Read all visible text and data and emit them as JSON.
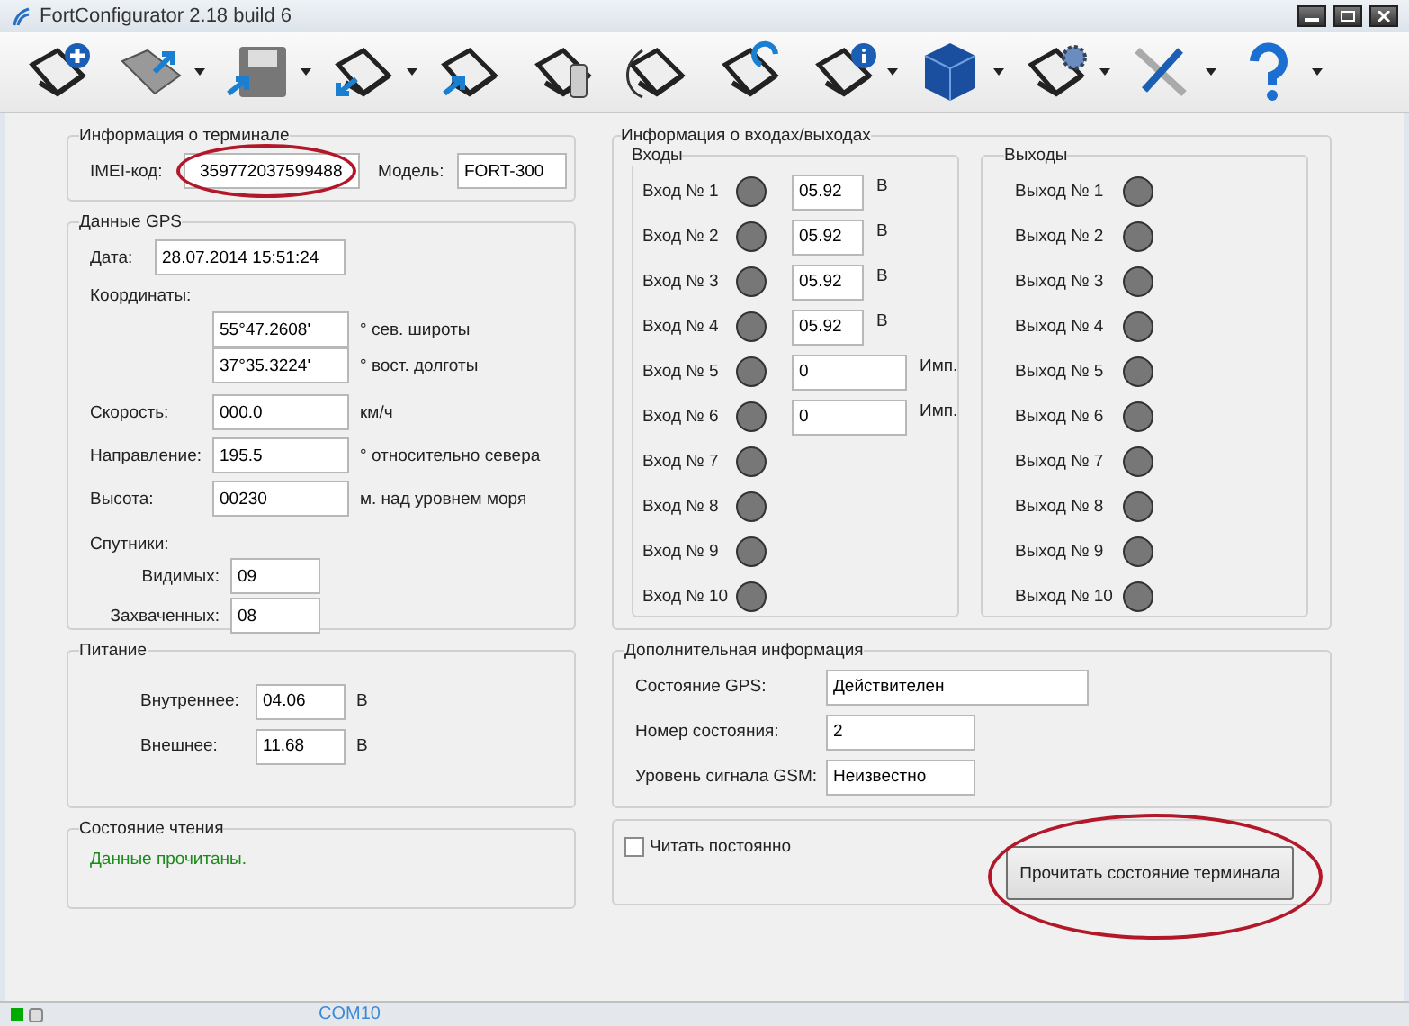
{
  "window": {
    "title": "FortConfigurator 2.18 build 6"
  },
  "toolbar": [
    {
      "kind": "add",
      "dropdown": false
    },
    {
      "kind": "folder",
      "dropdown": true
    },
    {
      "kind": "save",
      "dropdown": true
    },
    {
      "kind": "download",
      "dropdown": true
    },
    {
      "kind": "upload",
      "dropdown": false
    },
    {
      "kind": "phone",
      "dropdown": false
    },
    {
      "kind": "cable",
      "dropdown": false
    },
    {
      "kind": "sync",
      "dropdown": false
    },
    {
      "kind": "info",
      "dropdown": true
    },
    {
      "kind": "cube",
      "dropdown": true
    },
    {
      "kind": "gear",
      "dropdown": true
    },
    {
      "kind": "tools",
      "dropdown": true
    },
    {
      "kind": "help",
      "dropdown": true
    }
  ],
  "terminal": {
    "title": "Информация о терминале",
    "imei_label": "IMEI-код:",
    "imei": "359772037599488",
    "imei_highlighted": true,
    "model_label": "Модель:",
    "model": "FORT-300"
  },
  "gps": {
    "title": "Данные GPS",
    "date_label": "Дата:",
    "date": "28.07.2014 15:51:24",
    "coords_label": "Координаты:",
    "coords": [
      {
        "value": "55°47.2608'",
        "unit": "° сев. широты"
      },
      {
        "value": "37°35.3224'",
        "unit": "° вост. долготы"
      }
    ],
    "rows": [
      {
        "label": "Скорость:",
        "value": "000.0",
        "unit": "км/ч"
      },
      {
        "label": "Направление:",
        "value": "195.5",
        "unit": "° относительно севера"
      },
      {
        "label": "Высота:",
        "value": "00230",
        "unit": "м. над уровнем моря"
      }
    ],
    "sats_label": "Спутники:",
    "sats": [
      {
        "label": "Видимых:",
        "value": "09"
      },
      {
        "label": "Захваченных:",
        "value": "08"
      }
    ]
  },
  "power": {
    "title": "Питание",
    "rows": [
      {
        "label": "Внутреннее:",
        "value": "04.06",
        "unit": "В"
      },
      {
        "label": "Внешнее:",
        "value": "11.68",
        "unit": "В"
      }
    ]
  },
  "read_state": {
    "title": "Состояние чтения",
    "message": "Данные прочитаны."
  },
  "io": {
    "title": "Информация о входах/выходах",
    "inputs_title": "Входы",
    "inputs": [
      {
        "label": "Вход № 1",
        "on": false,
        "kind": "voltage",
        "value": "05.92",
        "unit": "В"
      },
      {
        "label": "Вход № 2",
        "on": false,
        "kind": "voltage",
        "value": "05.92",
        "unit": "В"
      },
      {
        "label": "Вход № 3",
        "on": false,
        "kind": "voltage",
        "value": "05.92",
        "unit": "В"
      },
      {
        "label": "Вход № 4",
        "on": false,
        "kind": "voltage",
        "value": "05.92",
        "unit": "В"
      },
      {
        "label": "Вход № 5",
        "on": false,
        "kind": "counter",
        "value": "0",
        "unit": "Имп."
      },
      {
        "label": "Вход № 6",
        "on": false,
        "kind": "counter",
        "value": "0",
        "unit": "Имп."
      },
      {
        "label": "Вход № 7",
        "on": false,
        "kind": "plain"
      },
      {
        "label": "Вход № 8",
        "on": false,
        "kind": "plain"
      },
      {
        "label": "Вход № 9",
        "on": false,
        "kind": "plain"
      },
      {
        "label": "Вход № 10",
        "on": false,
        "kind": "plain"
      }
    ],
    "outputs_title": "Выходы",
    "outputs": [
      {
        "label": "Выход № 1",
        "on": false
      },
      {
        "label": "Выход № 2",
        "on": false
      },
      {
        "label": "Выход № 3",
        "on": false
      },
      {
        "label": "Выход № 4",
        "on": false
      },
      {
        "label": "Выход № 5",
        "on": false
      },
      {
        "label": "Выход № 6",
        "on": false
      },
      {
        "label": "Выход № 7",
        "on": false
      },
      {
        "label": "Выход № 8",
        "on": false
      },
      {
        "label": "Выход № 9",
        "on": false
      },
      {
        "label": "Выход № 10",
        "on": false
      }
    ]
  },
  "extra": {
    "title": "Дополнительная информация",
    "rows": [
      {
        "label": "Состояние GPS:",
        "value": "Действителен",
        "kind": "wide"
      },
      {
        "label": "Номер состояния:",
        "value": "2",
        "kind": "narrow"
      },
      {
        "label": "Уровень сигнала GSM:",
        "value": "Неизвестно",
        "kind": "narrow"
      }
    ]
  },
  "reading": {
    "continuous_label": "Читать постоянно",
    "continuous_checked": false,
    "button": "Прочитать состояние терминала",
    "button_highlighted": true
  },
  "status_bar": {
    "connected": true,
    "port": "COM10"
  }
}
